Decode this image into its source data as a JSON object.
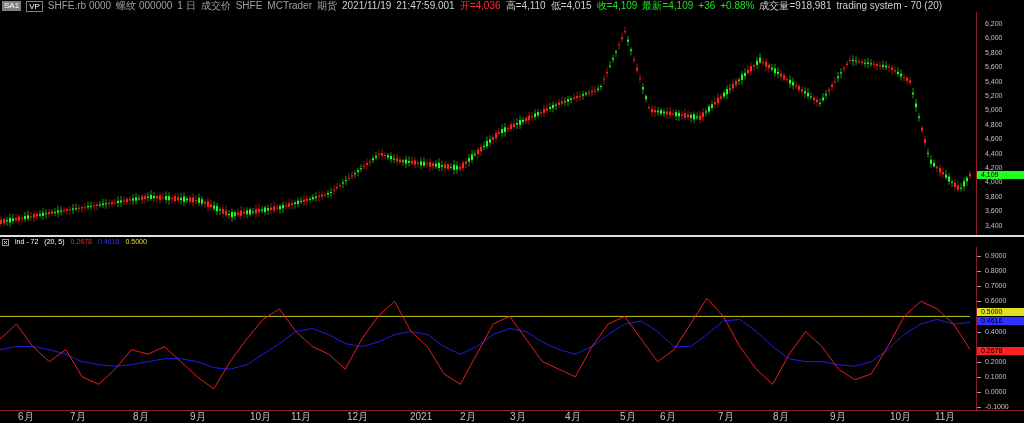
{
  "toolbar": {
    "symbol_button": "SA1",
    "vp_button": "VP"
  },
  "header_fields": [
    {
      "text": "SHFE.rb 0000",
      "kind": "muted"
    },
    {
      "text": "螺纹 000000",
      "kind": "muted"
    },
    {
      "text": "1 日",
      "kind": "muted"
    },
    {
      "text": "成交价",
      "kind": "muted"
    },
    {
      "text": "SHFE",
      "kind": "muted"
    },
    {
      "text": "MCTrader",
      "kind": "muted"
    },
    {
      "text": "期货",
      "kind": "muted"
    },
    {
      "text": "2021/11/19",
      "kind": "plain"
    },
    {
      "text": "21:47:59.001",
      "kind": "plain"
    },
    {
      "text": "开=4,036",
      "kind": "down"
    },
    {
      "text": "高=4,110",
      "kind": "plain"
    },
    {
      "text": "低=4,015",
      "kind": "plain"
    },
    {
      "text": "收=4,109",
      "kind": "up"
    },
    {
      "text": "最新=4,109",
      "kind": "up"
    },
    {
      "text": "+36",
      "kind": "up"
    },
    {
      "text": "+0.88%",
      "kind": "up"
    },
    {
      "text": "成交量=918,981",
      "kind": "plain"
    },
    {
      "text": "trading system - 70 (20)",
      "kind": "plain"
    }
  ],
  "price_panel": {
    "y_ticks": [
      "6,200",
      "6,000",
      "5,800",
      "5,600",
      "5,400",
      "5,200",
      "5,000",
      "4,800",
      "4,600",
      "4,400",
      "4,200",
      "4,000",
      "3,800",
      "3,600",
      "3,400"
    ],
    "last_price": "4,109"
  },
  "indicator_panel": {
    "name": "ind - 72",
    "params": "(20, 5)",
    "values": [
      {
        "text": "0.2678",
        "kind": "signal"
      },
      {
        "text": "0.4616",
        "kind": "average"
      },
      {
        "text": "0.5000",
        "kind": "threshold"
      }
    ],
    "tags": [
      {
        "text": "0.5000",
        "kind": "threshold"
      },
      {
        "text": "0.4616",
        "kind": "average"
      },
      {
        "text": "0.2678",
        "kind": "signal"
      }
    ],
    "chart_data": {
      "type": "line",
      "ylim": [
        -0.12,
        0.96
      ],
      "yticks": [
        {
          "value": 0.9,
          "label": "0.9000"
        },
        {
          "value": 0.8,
          "label": "0.8000"
        },
        {
          "value": 0.7,
          "label": "0.7000"
        },
        {
          "value": 0.6,
          "label": "0.6000"
        },
        {
          "value": 0.4,
          "label": "0.4000"
        },
        {
          "value": 0.2,
          "label": "0.2000"
        },
        {
          "value": 0.1,
          "label": "0.1000"
        },
        {
          "value": 0.0,
          "label": "0.0000"
        },
        {
          "value": -0.1,
          "label": "-0.1000"
        }
      ],
      "series": [
        {
          "color": "#ff2020",
          "values": [
            0.35,
            0.45,
            0.3,
            0.2,
            0.28,
            0.1,
            0.05,
            0.15,
            0.28,
            0.25,
            0.3,
            0.2,
            0.1,
            0.02,
            0.2,
            0.35,
            0.48,
            0.55,
            0.4,
            0.3,
            0.25,
            0.15,
            0.35,
            0.5,
            0.6,
            0.4,
            0.3,
            0.12,
            0.05,
            0.25,
            0.45,
            0.5,
            0.35,
            0.2,
            0.15,
            0.1,
            0.3,
            0.45,
            0.5,
            0.35,
            0.2,
            0.28,
            0.45,
            0.62,
            0.5,
            0.3,
            0.15,
            0.05,
            0.25,
            0.4,
            0.3,
            0.15,
            0.08,
            0.12,
            0.3,
            0.5,
            0.6,
            0.55,
            0.45,
            0.28
          ]
        },
        {
          "color": "#2020ff",
          "values": [
            0.28,
            0.3,
            0.3,
            0.28,
            0.25,
            0.2,
            0.18,
            0.17,
            0.18,
            0.2,
            0.22,
            0.22,
            0.2,
            0.16,
            0.15,
            0.18,
            0.25,
            0.32,
            0.4,
            0.42,
            0.38,
            0.32,
            0.3,
            0.33,
            0.38,
            0.4,
            0.38,
            0.3,
            0.25,
            0.3,
            0.38,
            0.42,
            0.4,
            0.33,
            0.28,
            0.25,
            0.3,
            0.38,
            0.45,
            0.47,
            0.4,
            0.3,
            0.3,
            0.38,
            0.47,
            0.48,
            0.4,
            0.3,
            0.22,
            0.2,
            0.2,
            0.18,
            0.17,
            0.2,
            0.28,
            0.38,
            0.45,
            0.48,
            0.45,
            0.46
          ]
        },
        {
          "color": "#e0e020",
          "values": [
            0.5,
            0.5,
            0.5,
            0.5,
            0.5,
            0.5,
            0.5,
            0.5,
            0.5,
            0.5,
            0.5,
            0.5,
            0.5,
            0.5,
            0.5,
            0.5,
            0.5,
            0.5,
            0.5,
            0.5,
            0.5,
            0.5,
            0.5,
            0.5,
            0.5,
            0.5,
            0.5,
            0.5,
            0.5,
            0.5,
            0.5,
            0.5,
            0.5,
            0.5,
            0.5,
            0.5,
            0.5,
            0.5,
            0.5,
            0.5,
            0.5,
            0.5,
            0.5,
            0.5,
            0.5,
            0.5,
            0.5,
            0.5,
            0.5,
            0.5,
            0.5,
            0.5,
            0.5,
            0.5,
            0.5,
            0.5,
            0.5,
            0.5,
            0.5,
            0.5
          ]
        }
      ]
    }
  },
  "time_axis": [
    "6月",
    "7月",
    "8月",
    "9月",
    "10月",
    "11月",
    "12月",
    "2021",
    "2月",
    "3月",
    "4月",
    "5月",
    "6月",
    "7月",
    "8月",
    "9月",
    "10月",
    "11月"
  ]
}
